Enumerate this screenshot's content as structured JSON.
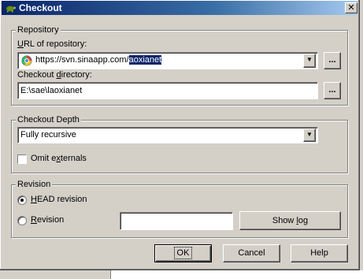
{
  "window": {
    "title": "Checkout",
    "close_glyph": "✕"
  },
  "repository": {
    "group_label": "Repository",
    "url_label_pre": "",
    "url_label_u": "U",
    "url_label_post": "RL of repository:",
    "url_prefix": "https://svn.sinaapp.com/",
    "url_selected": "aoxianet",
    "browse_label": "...",
    "dir_label_pre": "Checkout ",
    "dir_label_u": "d",
    "dir_label_post": "irectory:",
    "dir_value": "E:\\sae\\laoxianet"
  },
  "depth": {
    "group_label": "Checkout Depth",
    "selected": "Fully recursive",
    "omit_pre": "Omit e",
    "omit_u": "x",
    "omit_post": "ternals",
    "omit_checked": false
  },
  "revision": {
    "group_label": "Revision",
    "head_pre": "",
    "head_u": "H",
    "head_post": "EAD revision",
    "rev_pre": "",
    "rev_u": "R",
    "rev_post": "evision",
    "rev_value": "",
    "show_log_pre": "Show ",
    "show_log_u": "l",
    "show_log_post": "og",
    "selected": "head"
  },
  "buttons": {
    "ok": "OK",
    "cancel": "Cancel",
    "help": "Help"
  },
  "icons": {
    "title": "tortoise-icon",
    "url": "globe-icon"
  }
}
